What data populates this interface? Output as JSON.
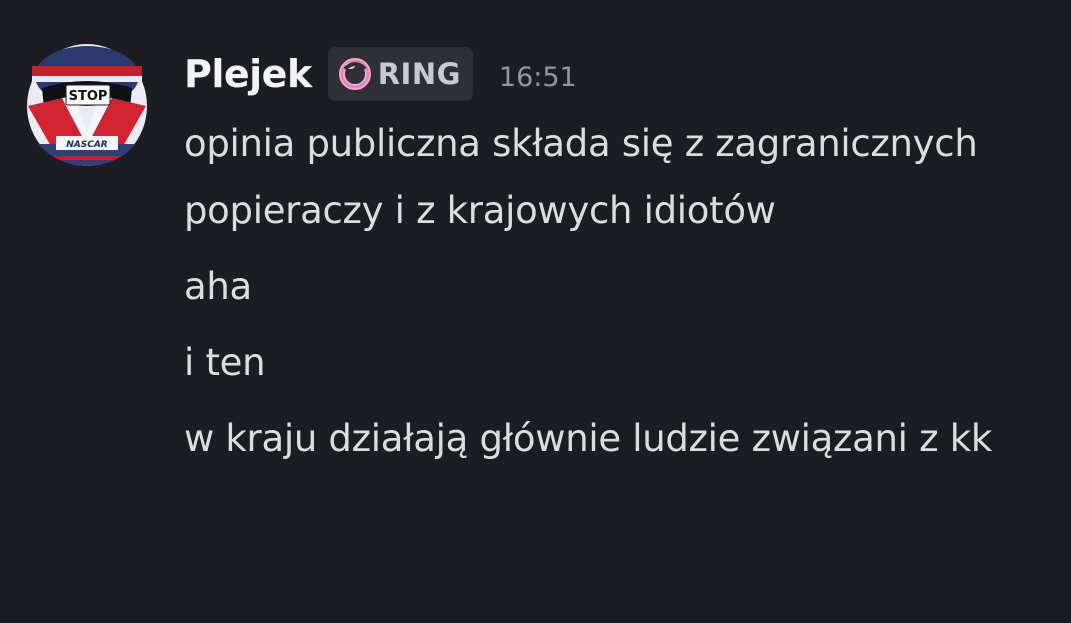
{
  "author": {
    "username": "Plejek",
    "tag": {
      "label": "RING",
      "icon": "pink-ring-icon",
      "accent_color": "#f4a6d0"
    },
    "timestamp": "16:51",
    "avatar": {
      "icon": "racing-helmet-avatar",
      "stop_text": "STOP",
      "brand_text": "NASCAR"
    }
  },
  "messages": [
    {
      "text": "opinia publiczna składa się z zagranicznych popieraczy i z krajowych idiotów"
    },
    {
      "text": "aha"
    },
    {
      "text": "i ten"
    },
    {
      "text": "w kraju działają głównie ludzie związani z kk"
    }
  ],
  "colors": {
    "background": "#1c1d22",
    "username": "#f2f3f5",
    "message_text": "#dbdee1",
    "timestamp": "#94979e",
    "tag_background": "#2e3036"
  }
}
